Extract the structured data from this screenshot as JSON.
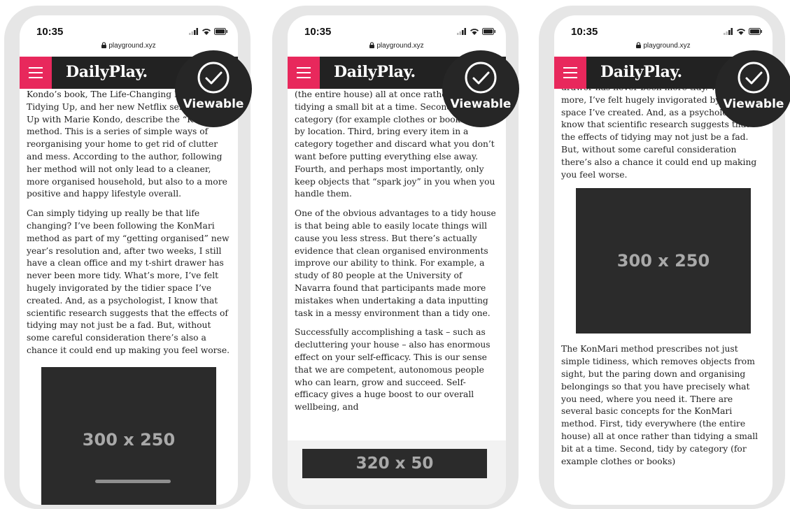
{
  "phones": [
    {
      "status": {
        "time": "10:35",
        "url": "playground.xyz"
      },
      "nav": {
        "logo": "DailyPlay."
      },
      "paragraphs": [
        "Kondo’s book, The Life-Changing Magic of Tidying Up, and her new Netflix series Tidying Up with Marie Kondo, describe the “KonMari” method. This is a series of simple ways of reorganising your home to get rid of clutter and mess. According to the author, following her method will not only lead to a cleaner, more organised household, but also to a more positive and happy lifestyle overall.",
        "Can simply tidying up really be that life changing? I’ve been following the KonMari method as part of my “getting organised” new year’s resolution and, after two weeks, I still have a clean office and my t-shirt drawer has never been more tidy. What’s more, I’ve felt hugely invigorated by the tidier space I’ve created. And, as a psychologist, I know that scientific research suggests that the effects of tidying may not just be a fad. But, without some careful consideration there’s also a chance it could end up making you feel worse."
      ],
      "ad_label": "300 x 250"
    },
    {
      "status": {
        "time": "10:35",
        "url": "playground.xyz"
      },
      "nav": {
        "logo": "DailyPlay."
      },
      "paragraphs": [
        "(the entire house) all at once rather than tidying a small bit at a time. Second, tidy by category (for example clothes or books), not by location. Third, bring every item in a category together and discard what you don’t want before putting everything else away. Fourth, and perhaps most importantly, only keep objects that “spark joy” in you when you handle them.",
        "One of the obvious advantages to a tidy house is that being able to easily locate things will cause you less stress. But there’s actually evidence that clean organised environments improve our ability to think. For example, a study of 80 people at the University of Navarra found that participants made more mistakes when undertaking a data inputting task in a messy environment than a tidy one.",
        "Successfully accomplishing a task – such as decluttering your house – also has enormous effect on your self-efficacy. This is our sense that we are competent, autonomous people who can learn, grow and succeed. Self-efficacy gives a huge boost to our overall wellbeing, and"
      ],
      "ad_label": "320 x 50"
    },
    {
      "status": {
        "time": "10:35",
        "url": "playground.xyz"
      },
      "nav": {
        "logo": "DailyPlay."
      },
      "paragraphs_before": [
        "drawer has never been more tidy. What’s more, I’ve felt hugely invigorated by the tidier space I’ve created. And, as a psychologist, I know that scientific research suggests that the effects of tidying may not just be a fad. But, without some careful consideration there’s also a chance it could end up making you feel worse."
      ],
      "ad_label": "300 x 250",
      "paragraphs_after": [
        "The KonMari method prescribes not just simple tidiness, which removes objects from sight, but the paring down and organising belongings so that you have precisely what you need, where you need it. There are several basic concepts for the KonMari method. First, tidy everywhere (the entire house) all at once rather than tidying a small bit at a time. Second, tidy by category (for example clothes or books)"
      ]
    }
  ],
  "badge": {
    "label": "Viewable"
  },
  "colors": {
    "brand_pink": "#e8285c",
    "nav_bg": "#222222",
    "ad_bg": "#2b2b2b",
    "ad_text": "#a9a9a9",
    "badge_bg": "#262626"
  }
}
